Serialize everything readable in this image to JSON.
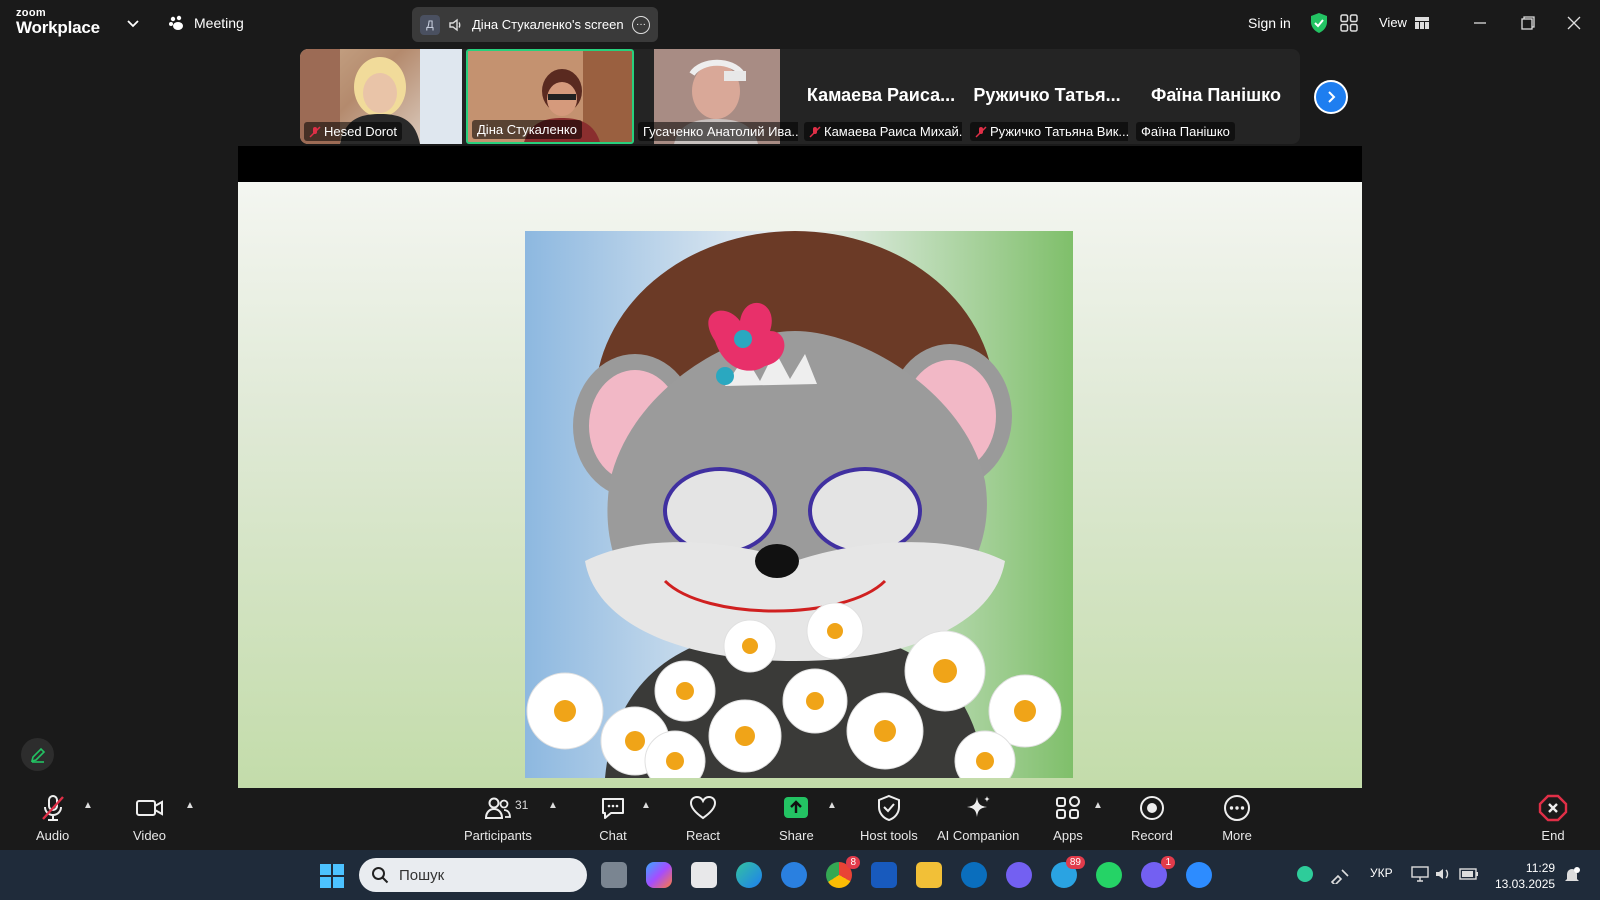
{
  "app": {
    "logo_small": "zoom",
    "logo_big": "Workplace",
    "meeting_label": "Meeting",
    "sharing_avatar_letter": "Д",
    "sharing_label": "Діна Стукаленко's screen",
    "sign_in": "Sign in",
    "view_label": "View"
  },
  "participants_strip": [
    {
      "name": "Hesed Dorot",
      "muted": true
    },
    {
      "name": "Діна Стукаленко",
      "muted": false,
      "active": true
    },
    {
      "name": "Гусаченко Анатолий Ива...",
      "muted": false
    },
    {
      "display": "Камаева  Раиса...",
      "name": "Камаева Раиса Михай...",
      "muted": true
    },
    {
      "display": "Ружичко  Татья...",
      "name": "Ружичко Татьяна Вик...",
      "muted": true
    },
    {
      "display": "Фаїна Панішко",
      "name": "Фаїна Панішко",
      "muted": false
    }
  ],
  "toolbar": {
    "audio": "Audio",
    "video": "Video",
    "participants": "Participants",
    "participants_count": "31",
    "chat": "Chat",
    "react": "React",
    "share": "Share",
    "host_tools": "Host tools",
    "ai_companion": "AI Companion",
    "apps": "Apps",
    "record": "Record",
    "more": "More",
    "end": "End"
  },
  "taskbar": {
    "search_placeholder": "Пошук",
    "chrome_badge": "8",
    "telegram_badge": "89",
    "viber_badge": "1",
    "language": "УКР",
    "time": "11:29",
    "date": "13.03.2025"
  },
  "colors": {
    "accent_green": "#28d07d",
    "share_green": "#23c363",
    "end_red": "#e02f47",
    "blue": "#1e7ef0"
  }
}
